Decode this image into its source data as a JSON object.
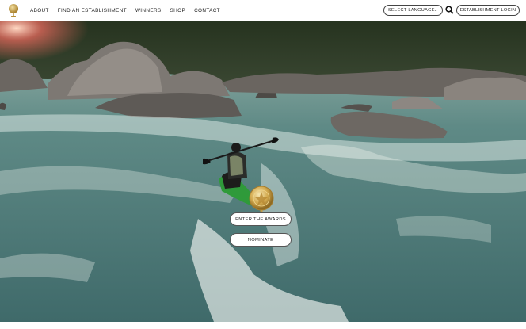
{
  "nav": {
    "logo_icon": "award-seal-icon",
    "items": [
      {
        "label": "ABOUT"
      },
      {
        "label": "FIND AN ESTABLISHMENT"
      },
      {
        "label": "WINNERS"
      },
      {
        "label": "SHOP"
      },
      {
        "label": "CONTACT"
      }
    ],
    "language_label": "SELECT LANGUAGE",
    "search_icon": "search-icon",
    "login_label": "ESTABLISHMENT LOGIN"
  },
  "hero": {
    "image": "kayaker-in-river-rapids",
    "enter_label": "ENTER THE AWARDS",
    "nominate_label": "NOMINATE"
  },
  "colors": {
    "gold": "#c9a24a",
    "water": "#5f8a86",
    "foam": "#e8efe9"
  }
}
